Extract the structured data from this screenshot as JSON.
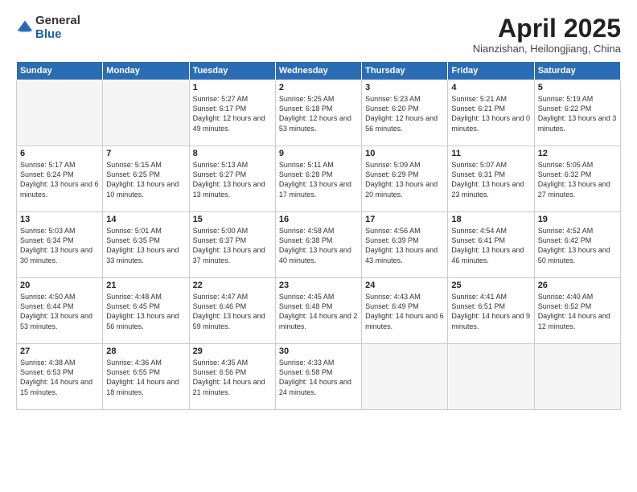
{
  "logo": {
    "general": "General",
    "blue": "Blue"
  },
  "title": "April 2025",
  "subtitle": "Nianzishan, Heilongjiang, China",
  "days_header": [
    "Sunday",
    "Monday",
    "Tuesday",
    "Wednesday",
    "Thursday",
    "Friday",
    "Saturday"
  ],
  "weeks": [
    [
      {
        "day": "",
        "info": ""
      },
      {
        "day": "",
        "info": ""
      },
      {
        "day": "1",
        "info": "Sunrise: 5:27 AM\nSunset: 6:17 PM\nDaylight: 12 hours\nand 49 minutes."
      },
      {
        "day": "2",
        "info": "Sunrise: 5:25 AM\nSunset: 6:18 PM\nDaylight: 12 hours\nand 53 minutes."
      },
      {
        "day": "3",
        "info": "Sunrise: 5:23 AM\nSunset: 6:20 PM\nDaylight: 12 hours\nand 56 minutes."
      },
      {
        "day": "4",
        "info": "Sunrise: 5:21 AM\nSunset: 6:21 PM\nDaylight: 13 hours\nand 0 minutes."
      },
      {
        "day": "5",
        "info": "Sunrise: 5:19 AM\nSunset: 6:22 PM\nDaylight: 13 hours\nand 3 minutes."
      }
    ],
    [
      {
        "day": "6",
        "info": "Sunrise: 5:17 AM\nSunset: 6:24 PM\nDaylight: 13 hours\nand 6 minutes."
      },
      {
        "day": "7",
        "info": "Sunrise: 5:15 AM\nSunset: 6:25 PM\nDaylight: 13 hours\nand 10 minutes."
      },
      {
        "day": "8",
        "info": "Sunrise: 5:13 AM\nSunset: 6:27 PM\nDaylight: 13 hours\nand 13 minutes."
      },
      {
        "day": "9",
        "info": "Sunrise: 5:11 AM\nSunset: 6:28 PM\nDaylight: 13 hours\nand 17 minutes."
      },
      {
        "day": "10",
        "info": "Sunrise: 5:09 AM\nSunset: 6:29 PM\nDaylight: 13 hours\nand 20 minutes."
      },
      {
        "day": "11",
        "info": "Sunrise: 5:07 AM\nSunset: 6:31 PM\nDaylight: 13 hours\nand 23 minutes."
      },
      {
        "day": "12",
        "info": "Sunrise: 5:05 AM\nSunset: 6:32 PM\nDaylight: 13 hours\nand 27 minutes."
      }
    ],
    [
      {
        "day": "13",
        "info": "Sunrise: 5:03 AM\nSunset: 6:34 PM\nDaylight: 13 hours\nand 30 minutes."
      },
      {
        "day": "14",
        "info": "Sunrise: 5:01 AM\nSunset: 6:35 PM\nDaylight: 13 hours\nand 33 minutes."
      },
      {
        "day": "15",
        "info": "Sunrise: 5:00 AM\nSunset: 6:37 PM\nDaylight: 13 hours\nand 37 minutes."
      },
      {
        "day": "16",
        "info": "Sunrise: 4:58 AM\nSunset: 6:38 PM\nDaylight: 13 hours\nand 40 minutes."
      },
      {
        "day": "17",
        "info": "Sunrise: 4:56 AM\nSunset: 6:39 PM\nDaylight: 13 hours\nand 43 minutes."
      },
      {
        "day": "18",
        "info": "Sunrise: 4:54 AM\nSunset: 6:41 PM\nDaylight: 13 hours\nand 46 minutes."
      },
      {
        "day": "19",
        "info": "Sunrise: 4:52 AM\nSunset: 6:42 PM\nDaylight: 13 hours\nand 50 minutes."
      }
    ],
    [
      {
        "day": "20",
        "info": "Sunrise: 4:50 AM\nSunset: 6:44 PM\nDaylight: 13 hours\nand 53 minutes."
      },
      {
        "day": "21",
        "info": "Sunrise: 4:48 AM\nSunset: 6:45 PM\nDaylight: 13 hours\nand 56 minutes."
      },
      {
        "day": "22",
        "info": "Sunrise: 4:47 AM\nSunset: 6:46 PM\nDaylight: 13 hours\nand 59 minutes."
      },
      {
        "day": "23",
        "info": "Sunrise: 4:45 AM\nSunset: 6:48 PM\nDaylight: 14 hours\nand 2 minutes."
      },
      {
        "day": "24",
        "info": "Sunrise: 4:43 AM\nSunset: 6:49 PM\nDaylight: 14 hours\nand 6 minutes."
      },
      {
        "day": "25",
        "info": "Sunrise: 4:41 AM\nSunset: 6:51 PM\nDaylight: 14 hours\nand 9 minutes."
      },
      {
        "day": "26",
        "info": "Sunrise: 4:40 AM\nSunset: 6:52 PM\nDaylight: 14 hours\nand 12 minutes."
      }
    ],
    [
      {
        "day": "27",
        "info": "Sunrise: 4:38 AM\nSunset: 6:53 PM\nDaylight: 14 hours\nand 15 minutes."
      },
      {
        "day": "28",
        "info": "Sunrise: 4:36 AM\nSunset: 6:55 PM\nDaylight: 14 hours\nand 18 minutes."
      },
      {
        "day": "29",
        "info": "Sunrise: 4:35 AM\nSunset: 6:56 PM\nDaylight: 14 hours\nand 21 minutes."
      },
      {
        "day": "30",
        "info": "Sunrise: 4:33 AM\nSunset: 6:58 PM\nDaylight: 14 hours\nand 24 minutes."
      },
      {
        "day": "",
        "info": ""
      },
      {
        "day": "",
        "info": ""
      },
      {
        "day": "",
        "info": ""
      }
    ]
  ]
}
